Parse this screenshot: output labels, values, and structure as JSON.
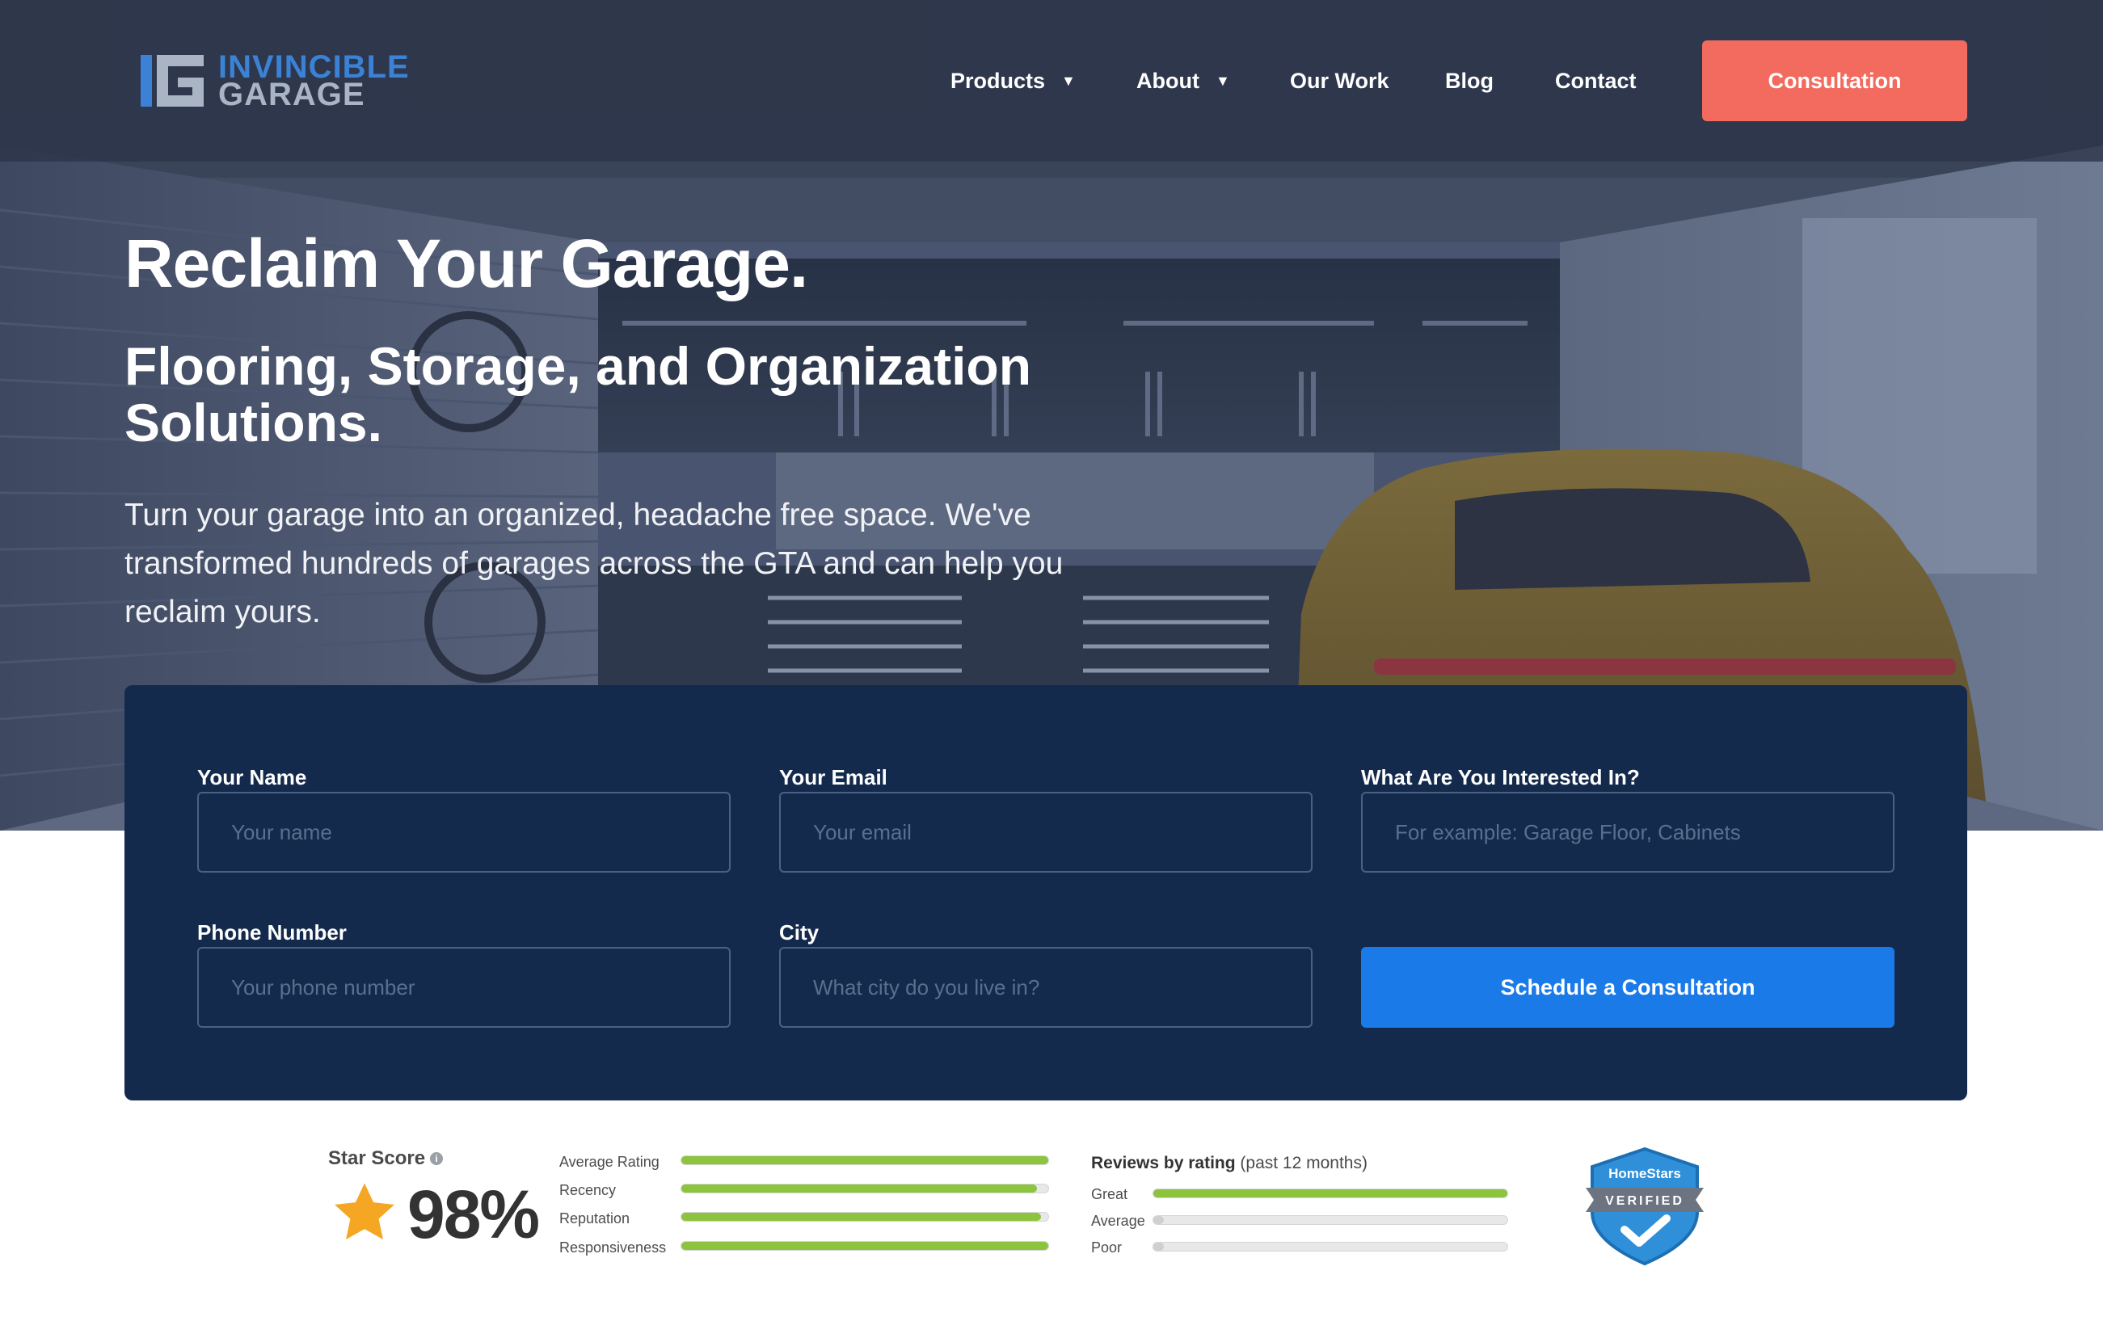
{
  "brand": {
    "line1": "INVINCIBLE",
    "line2": "GARAGE"
  },
  "nav": {
    "items": [
      {
        "label": "Products",
        "has_dropdown": true
      },
      {
        "label": "About",
        "has_dropdown": true
      },
      {
        "label": "Our Work",
        "has_dropdown": false
      },
      {
        "label": "Blog",
        "has_dropdown": false
      },
      {
        "label": "Contact",
        "has_dropdown": false
      }
    ],
    "dropdown_icon": "▼",
    "cta_label": "Consultation"
  },
  "hero": {
    "title": "Reclaim Your Garage.",
    "subtitle": "Flooring, Storage, and Organization Solutions.",
    "body": "Turn your garage into an organized, headache free space. We've transformed hundreds of garages across the GTA and can help you reclaim yours."
  },
  "form": {
    "name": {
      "label": "Your Name",
      "placeholder": "Your name"
    },
    "email": {
      "label": "Your Email",
      "placeholder": "Your email"
    },
    "interest": {
      "label": "What Are You Interested In?",
      "placeholder": "For example: Garage Floor, Cabinets"
    },
    "phone": {
      "label": "Phone Number",
      "placeholder": "Your phone number"
    },
    "city": {
      "label": "City",
      "placeholder": "What city do you live in?"
    },
    "submit_label": "Schedule a Consultation"
  },
  "reviews": {
    "star_score_label": "Star Score",
    "info_icon": "i",
    "score": "98%",
    "metrics": [
      {
        "label": "Average Rating",
        "fill": 1.0
      },
      {
        "label": "Recency",
        "fill": 0.97
      },
      {
        "label": "Reputation",
        "fill": 0.98
      },
      {
        "label": "Responsiveness",
        "fill": 1.0
      }
    ],
    "by_rating_title": "Reviews by rating",
    "by_rating_period": "(past 12 months)",
    "ratings": [
      {
        "label": "Great",
        "fill": 1.0
      },
      {
        "label": "Average",
        "fill": 0.03
      },
      {
        "label": "Poor",
        "fill": 0.03
      }
    ],
    "badge": {
      "line1": "HomeStars",
      "line2": "VERIFIED"
    }
  },
  "colors": {
    "header_bg": "#2c3548",
    "cta": "#f36a5e",
    "form_bg": "#142a4c",
    "submit": "#1a7ae8",
    "bar_green": "#8cc43d",
    "brand_blue": "#3b82d6"
  }
}
